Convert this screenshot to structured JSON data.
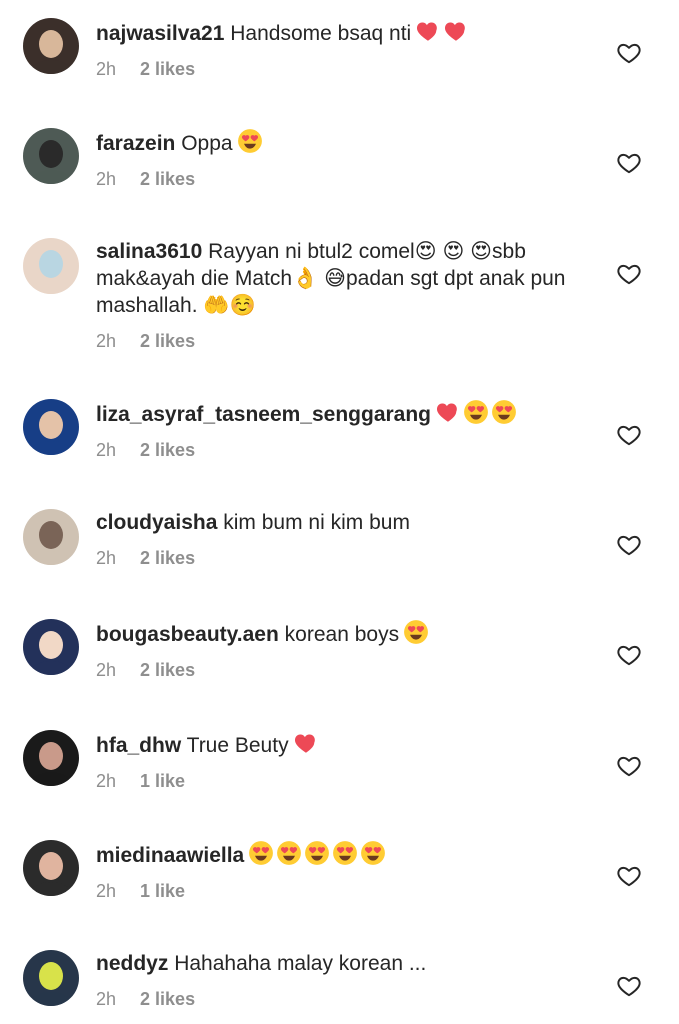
{
  "comments": [
    {
      "username": "najwasilva21",
      "text": "Handsome bsaq nti",
      "emojis": [
        "heart",
        "heart"
      ],
      "time": "2h",
      "likes": "2 likes",
      "avatar_colors": [
        "#3b2f2a",
        "#d8b79a"
      ]
    },
    {
      "username": "farazein",
      "text": "Oppa",
      "emojis": [
        "heart-eyes"
      ],
      "time": "2h",
      "likes": "2 likes",
      "avatar_colors": [
        "#4e5a55",
        "#2a2a2a"
      ]
    },
    {
      "username": "salina3610",
      "text": "Rayyan ni btul2 comel😍 😍 😍sbb mak&ayah die Match👌 😅padan sgt dpt anak pun mashallah. 🤲☺️",
      "emojis": [],
      "time": "2h",
      "likes": "2 likes",
      "avatar_colors": [
        "#e9d6c8",
        "#b9d6e2"
      ]
    },
    {
      "username": "liza_asyraf_tasneem_senggarang",
      "text": "",
      "emojis": [
        "heart",
        "heart-eyes",
        "heart-eyes"
      ],
      "time": "2h",
      "likes": "2 likes",
      "avatar_colors": [
        "#173e86",
        "#e4c2a8"
      ]
    },
    {
      "username": "cloudyaisha",
      "text": "kim bum ni kim bum",
      "emojis": [],
      "time": "2h",
      "likes": "2 likes",
      "avatar_colors": [
        "#cfc2b3",
        "#7a6457"
      ]
    },
    {
      "username": "bougasbeauty.aen",
      "text": "korean boys",
      "emojis": [
        "heart-eyes"
      ],
      "time": "2h",
      "likes": "2 likes",
      "avatar_colors": [
        "#23315a",
        "#f1d8c6"
      ]
    },
    {
      "username": "hfa_dhw",
      "text": "True Beuty",
      "emojis": [
        "heart"
      ],
      "time": "2h",
      "likes": "1 like",
      "avatar_colors": [
        "#1a1a1a",
        "#c99a8a"
      ]
    },
    {
      "username": "miedinaawiella",
      "text": "",
      "emojis": [
        "heart-eyes",
        "heart-eyes",
        "heart-eyes",
        "heart-eyes",
        "heart-eyes"
      ],
      "time": "2h",
      "likes": "1 like",
      "avatar_colors": [
        "#2b2b2b",
        "#e0b49f"
      ]
    },
    {
      "username": "neddyz",
      "text": "Hahahaha malay korean ...",
      "emojis": [],
      "time": "2h",
      "likes": "2 likes",
      "avatar_colors": [
        "#27364a",
        "#d8e24a"
      ]
    }
  ],
  "colors": {
    "text": "#262626",
    "meta": "#8e8e8e",
    "heart": "#ed4956",
    "like_outline": "#262626"
  },
  "icons": {
    "like": "heart-outline-icon"
  }
}
